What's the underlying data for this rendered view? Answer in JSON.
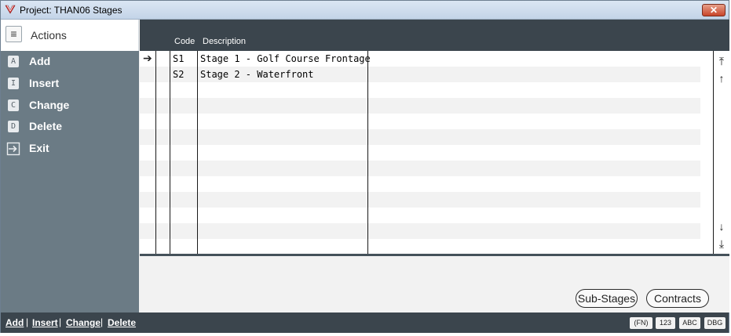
{
  "window": {
    "title": "Project: THAN06 Stages",
    "close_label": "✕"
  },
  "actions": {
    "title": "Actions",
    "items": [
      {
        "key": "A",
        "label": "Add"
      },
      {
        "key": "I",
        "label": "Insert"
      },
      {
        "key": "C",
        "label": "Change"
      },
      {
        "key": "D",
        "label": "Delete"
      },
      {
        "key": "",
        "label": "Exit"
      }
    ]
  },
  "grid": {
    "columns": [
      "Code",
      "Description"
    ],
    "pointer": "➔",
    "rows": [
      {
        "code": "S1",
        "description": "Stage 1 - Golf Course Frontage"
      },
      {
        "code": "S2",
        "description": "Stage 2 - Waterfront"
      }
    ]
  },
  "scroll": {
    "top": "⤒",
    "up": "↑",
    "down": "↓",
    "bottom": "⤓"
  },
  "buttons": {
    "sub_stages": "Sub-Stages",
    "contracts": "Contracts"
  },
  "statusbar": {
    "links": [
      "Add",
      "Insert",
      "Change",
      "Delete"
    ],
    "separator": "|",
    "badges": [
      "(FN)",
      "123",
      "ABC",
      "DBG"
    ]
  },
  "colors": {
    "sidebar": "#6b7b85",
    "header": "#3b454d",
    "alt_row": "#f2f2f2"
  }
}
